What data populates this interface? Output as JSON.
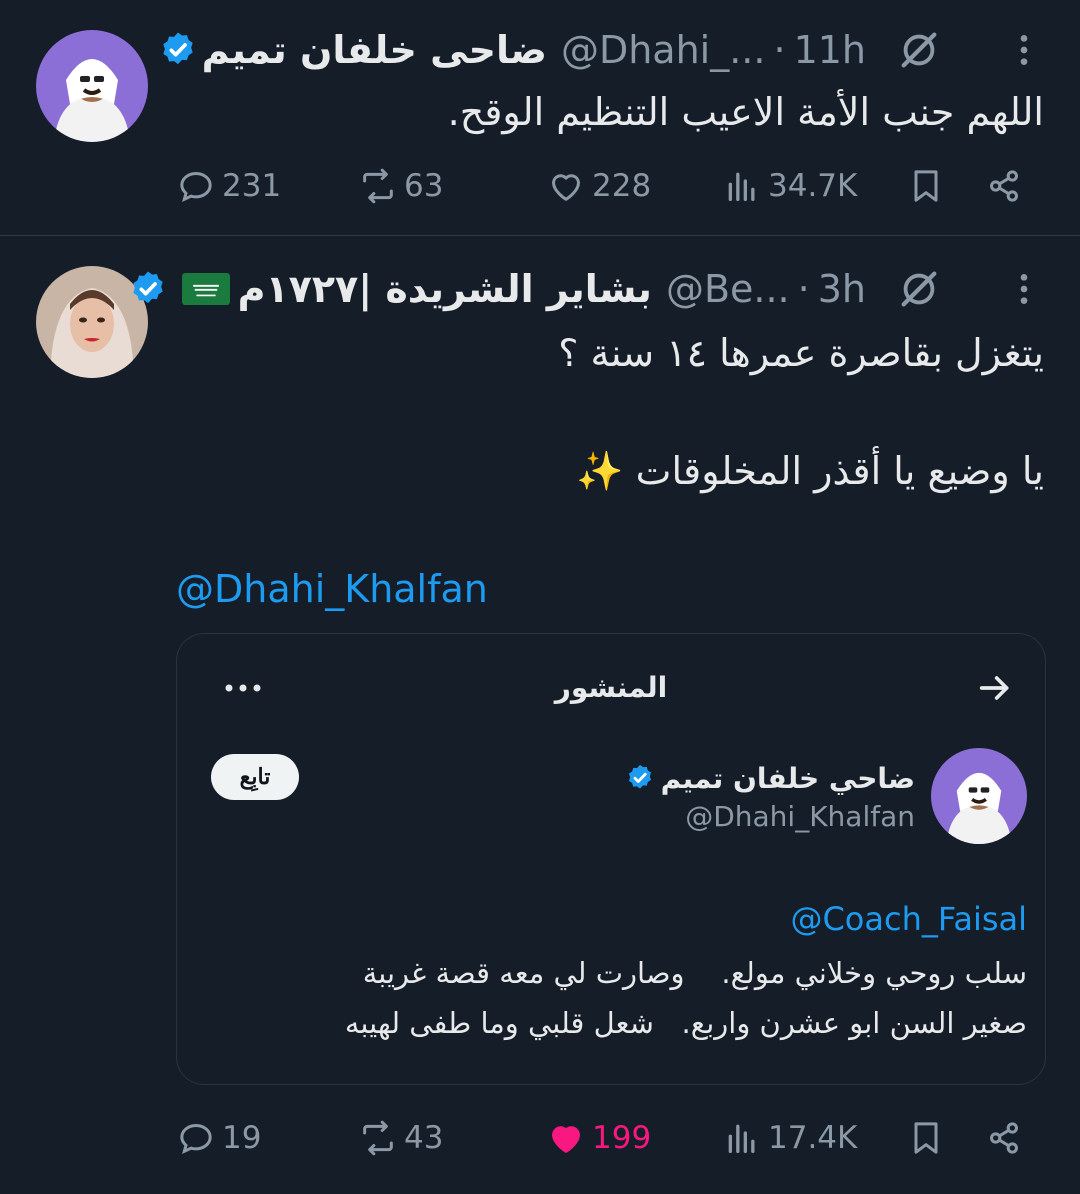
{
  "tweets": [
    {
      "author_name": "ضاحى خلفان تميم",
      "handle": "@Dhahi_...",
      "dot": "·",
      "time": "11h",
      "text": "اللهم جنب الأمة الاعيب التنظيم الوقح.",
      "replies": "231",
      "reposts": "63",
      "likes": "228",
      "views": "34.7K"
    },
    {
      "author_name": "بشاير الشريدة |١٧٢٧م",
      "handle": "@Be...",
      "dot": "·",
      "time": "3h",
      "text_line1": "يتغزل بقاصرة عمرها ١٤ سنة ؟",
      "text_line2": "يا وضيع يا أقذر المخلوقات ✨",
      "mention": "@Dhahi_Khalfan",
      "replies": "19",
      "reposts": "43",
      "likes": "199",
      "views": "17.4K",
      "quote": {
        "title": "المنشور",
        "author_name": "ضاحي خلفان تميم",
        "handle": "@Dhahi_Khalfan",
        "follow_label": "تابِع",
        "mention": "@Coach_Faisal",
        "line1": "سلب روحي وخلاني مولع.    وصارت لي معه قصة غريبة",
        "line2": "صغير السن ابو عشرن واربع.   شعل قلبي وما طفى لهيبه"
      }
    }
  ],
  "icons": {
    "verified": "verified-badge-icon",
    "grok": "grok-icon",
    "more": "more-options-icon",
    "reply": "reply-icon",
    "repost": "repost-icon",
    "like": "like-icon",
    "views": "views-icon",
    "bookmark": "bookmark-icon",
    "share": "share-icon",
    "flag": "saudi-flag-icon"
  },
  "colors": {
    "background": "#151d29",
    "text": "#e7e9ea",
    "secondary": "#8b98a5",
    "accent": "#1d9bf0",
    "like": "#f91880"
  }
}
